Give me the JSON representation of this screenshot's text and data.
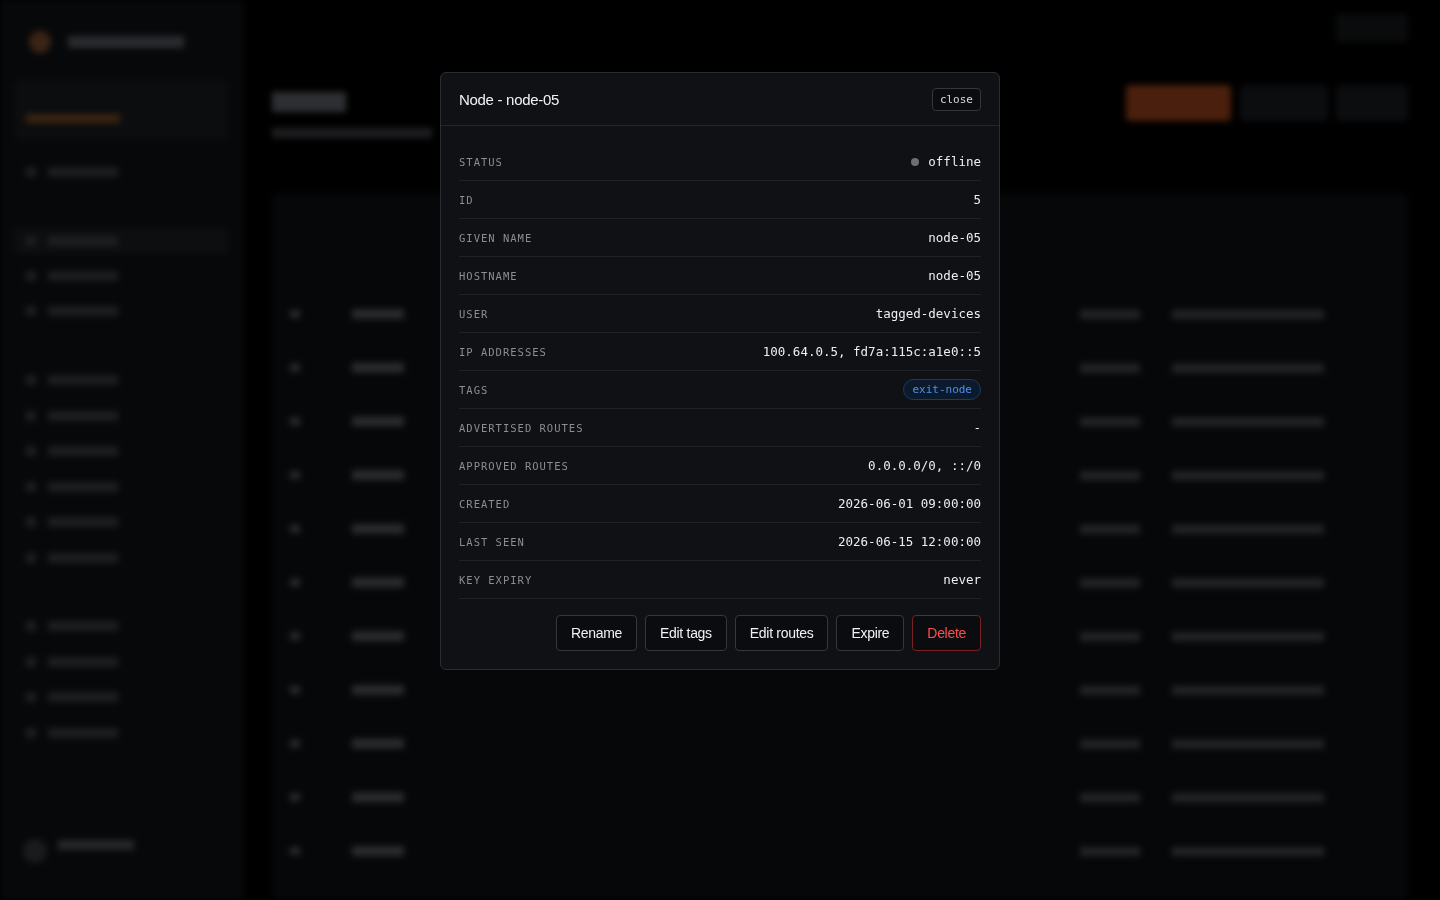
{
  "dialog": {
    "title": "Node - node-05",
    "close_label": "close",
    "fields": [
      {
        "kind": "status",
        "label": "STATUS",
        "value": "offline",
        "color": "#6b6f76"
      },
      {
        "kind": "text",
        "label": "ID",
        "value": "5"
      },
      {
        "kind": "text",
        "label": "GIVEN NAME",
        "value": "node-05"
      },
      {
        "kind": "text",
        "label": "HOSTNAME",
        "value": "node-05"
      },
      {
        "kind": "text",
        "label": "USER",
        "value": "tagged-devices"
      },
      {
        "kind": "text",
        "label": "IP ADDRESSES",
        "value": "100.64.0.5, fd7a:115c:a1e0::5"
      },
      {
        "kind": "tags",
        "label": "TAGS",
        "tags": [
          "exit-node"
        ]
      },
      {
        "kind": "text",
        "label": "ADVERTISED ROUTES",
        "value": "-"
      },
      {
        "kind": "text",
        "label": "APPROVED ROUTES",
        "value": "0.0.0.0/0, ::/0"
      },
      {
        "kind": "text",
        "label": "CREATED",
        "value": "2026-06-01 09:00:00"
      },
      {
        "kind": "text",
        "label": "LAST SEEN",
        "value": "2026-06-15 12:00:00"
      },
      {
        "kind": "text",
        "label": "KEY EXPIRY",
        "value": "never"
      }
    ],
    "actions": [
      {
        "label": "Rename",
        "kind": "normal"
      },
      {
        "label": "Edit tags",
        "kind": "normal"
      },
      {
        "label": "Edit routes",
        "kind": "normal"
      },
      {
        "label": "Expire",
        "kind": "normal"
      },
      {
        "label": "Delete",
        "kind": "danger"
      }
    ]
  }
}
